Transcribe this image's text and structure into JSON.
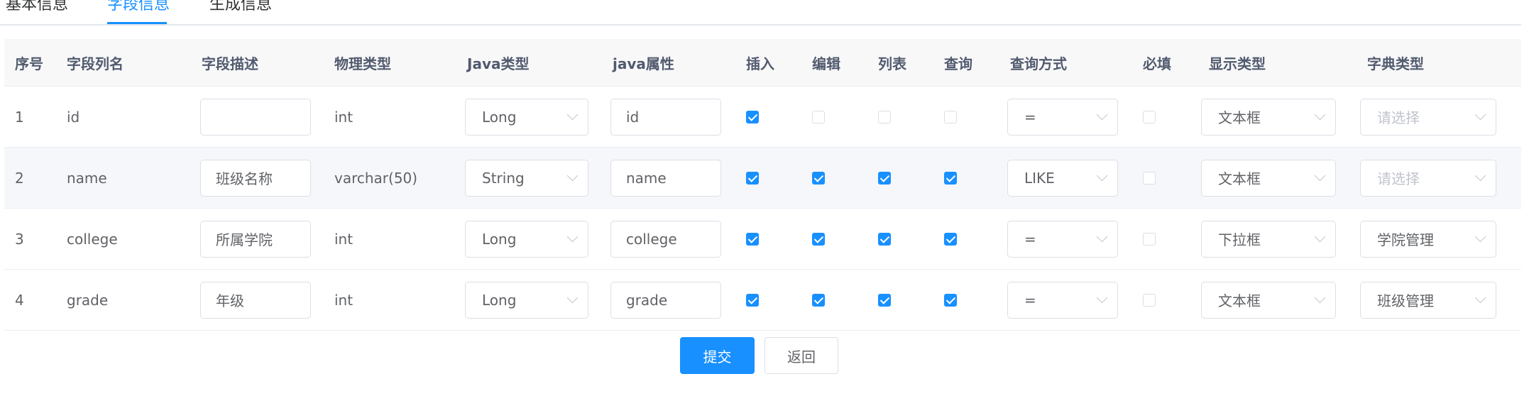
{
  "tabs": [
    {
      "label": "基本信息",
      "active": false
    },
    {
      "label": "字段信息",
      "active": true
    },
    {
      "label": "生成信息",
      "active": false
    }
  ],
  "colors": {
    "primary": "#1890ff",
    "border": "#dcdfe6",
    "header_bg": "#f8f8f9"
  },
  "table": {
    "headers": {
      "index": "序号",
      "column_name": "字段列名",
      "description": "字段描述",
      "physical_type": "物理类型",
      "java_type": "Java类型",
      "java_property": "java属性",
      "insert": "插入",
      "edit": "编辑",
      "list": "列表",
      "query": "查询",
      "query_mode": "查询方式",
      "required": "必填",
      "display_type": "显示类型",
      "dict_type": "字典类型"
    },
    "rows": [
      {
        "index": "1",
        "column_name": "id",
        "description": "",
        "physical_type": "int",
        "java_type": "Long",
        "java_property": "id",
        "insert": true,
        "edit": false,
        "list": false,
        "query": false,
        "query_mode": "=",
        "required": false,
        "display_type": "文本框",
        "dict_type": "",
        "dict_placeholder": "请选择"
      },
      {
        "index": "2",
        "column_name": "name",
        "description": "班级名称",
        "physical_type": "varchar(50)",
        "java_type": "String",
        "java_property": "name",
        "insert": true,
        "edit": true,
        "list": true,
        "query": true,
        "query_mode": "LIKE",
        "required": false,
        "display_type": "文本框",
        "dict_type": "",
        "dict_placeholder": "请选择"
      },
      {
        "index": "3",
        "column_name": "college",
        "description": "所属学院",
        "physical_type": "int",
        "java_type": "Long",
        "java_property": "college",
        "insert": true,
        "edit": true,
        "list": true,
        "query": true,
        "query_mode": "=",
        "required": false,
        "display_type": "下拉框",
        "dict_type": "学院管理",
        "dict_placeholder": "请选择"
      },
      {
        "index": "4",
        "column_name": "grade",
        "description": "年级",
        "physical_type": "int",
        "java_type": "Long",
        "java_property": "grade",
        "insert": true,
        "edit": true,
        "list": true,
        "query": true,
        "query_mode": "=",
        "required": false,
        "display_type": "文本框",
        "dict_type": "班级管理",
        "dict_placeholder": "请选择"
      }
    ]
  },
  "actions": {
    "submit": "提交",
    "back": "返回"
  }
}
